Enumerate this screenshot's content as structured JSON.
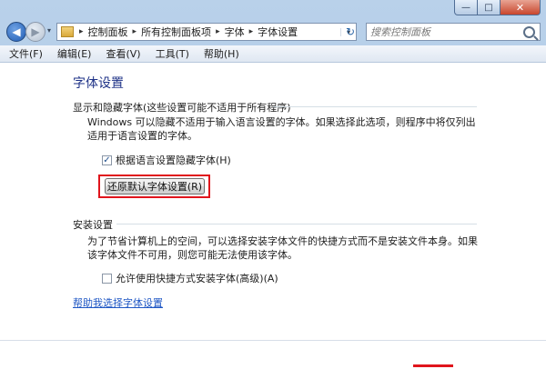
{
  "window": {
    "caption_minimize": "—",
    "caption_maximize": "□",
    "caption_close": "✕"
  },
  "navigation": {
    "back_symbol": "◀",
    "forward_symbol": "▶",
    "history_dropdown": "▾",
    "breadcrumbs": [
      "控制面板",
      "所有控制面板项",
      "字体",
      "字体设置"
    ],
    "separator": "▸",
    "address_dropdown": "▾",
    "refresh_symbol": "↻",
    "search_placeholder": "搜索控制面板"
  },
  "menubar": {
    "items": [
      "文件(F)",
      "编辑(E)",
      "查看(V)",
      "工具(T)",
      "帮助(H)"
    ]
  },
  "content": {
    "page_title": "字体设置",
    "section_display": {
      "heading": "显示和隐藏字体(这些设置可能不适用于所有程序)",
      "description": "Windows 可以隐藏不适用于输入语言设置的字体。如果选择此选项，则程序中将仅列出适用于语言设置的字体。",
      "checkbox_label": "根据语言设置隐藏字体(H)",
      "checkbox_checked": true,
      "checkmark": "✓",
      "button_label": "还原默认字体设置(R)"
    },
    "section_install": {
      "heading": "安装设置",
      "description": "为了节省计算机上的空间，可以选择安装字体文件的快捷方式而不是安装文件本身。如果该字体文件不可用，则您可能无法使用该字体。",
      "checkbox_label": "允许使用快捷方式安装字体(高级)(A)",
      "checkbox_checked": false
    },
    "help_link": "帮助我选择字体设置"
  },
  "colors": {
    "title_blue": "#1e3287",
    "link_blue": "#1e56c4",
    "highlight_red": "#e0141c"
  }
}
